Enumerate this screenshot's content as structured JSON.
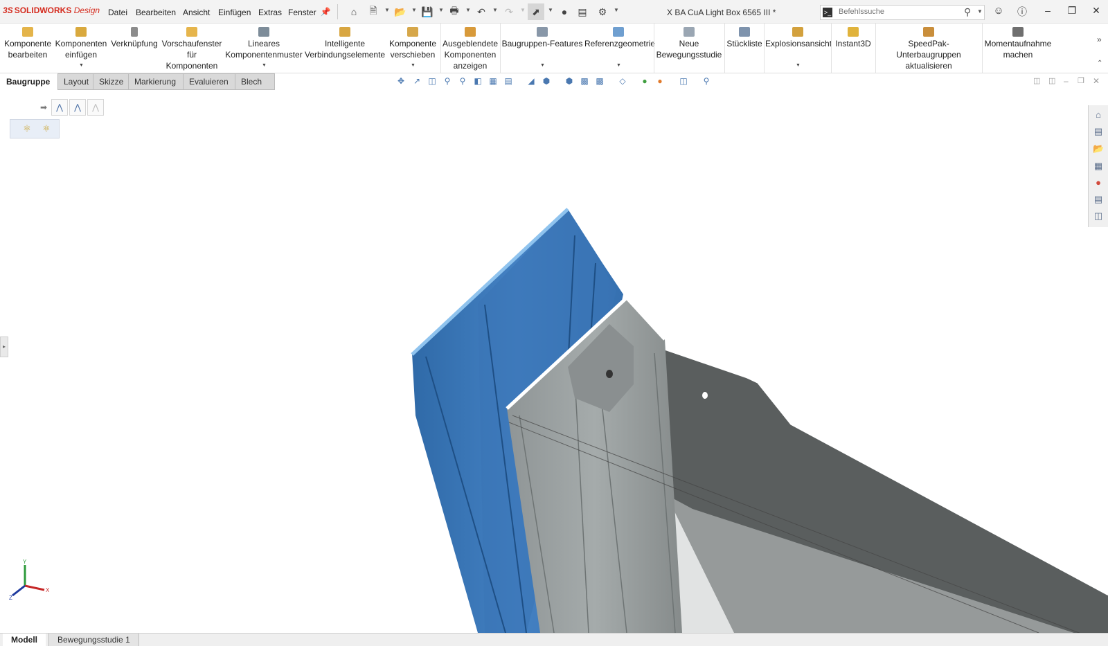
{
  "app": {
    "logo_text": "SOLIDWORKS",
    "logo_suffix": "Design",
    "ds_mark": "3S"
  },
  "menus": [
    "Datei",
    "Bearbeiten",
    "Ansicht",
    "Einfügen",
    "Extras",
    "Fenster"
  ],
  "document_title": "X BA CuA Light Box 6565 III *",
  "search": {
    "placeholder": "Befehlssuche"
  },
  "commands": [
    {
      "label": "Komponente\nbearbeiten",
      "icon": "edit-component-icon"
    },
    {
      "label": "Komponenten\neinfügen",
      "icon": "insert-components-icon"
    },
    {
      "label": "Verknüpfung",
      "icon": "mate-icon"
    },
    {
      "label": "Vorschaufenster\nfür\nKomponenten",
      "icon": "component-preview-icon"
    },
    {
      "label": "Lineares\nKomponentenmuster",
      "icon": "linear-pattern-icon"
    },
    {
      "label": "Intelligente\nVerbindungselemente",
      "icon": "smart-fasteners-icon"
    },
    {
      "label": "Komponente\nverschieben",
      "icon": "move-component-icon"
    },
    {
      "label": "Ausgeblendete\nKomponenten\nanzeigen",
      "icon": "show-hidden-icon"
    },
    {
      "label": "Baugruppen-Features",
      "icon": "assembly-features-icon"
    },
    {
      "label": "Referenzgeometrie",
      "icon": "reference-geometry-icon"
    },
    {
      "label": "Neue\nBewegungsstudie",
      "icon": "motion-study-icon"
    },
    {
      "label": "Stückliste",
      "icon": "bom-icon"
    },
    {
      "label": "Explosionsansicht",
      "icon": "exploded-view-icon"
    },
    {
      "label": "Instant3D",
      "icon": "instant3d-icon"
    },
    {
      "label": "SpeedPak-Unterbaugruppen\naktualisieren",
      "icon": "speedpak-icon"
    },
    {
      "label": "Momentaufnahme\nmachen",
      "icon": "camera-icon"
    }
  ],
  "tabs": [
    "Baugruppe",
    "Layout",
    "Skizze",
    "Markierung",
    "Evaluieren",
    "Blech"
  ],
  "active_tab": "Baugruppe",
  "bottom_tabs": [
    "Modell",
    "Bewegungsstudie 1"
  ],
  "active_bottom_tab": "Modell",
  "triad": {
    "x": "X",
    "y": "Y",
    "z": "Z"
  },
  "colors": {
    "accent": "#d52b1e",
    "profile_blue": "#3f7cc0",
    "profile_grey": "#9fa5a6",
    "panel_dark": "#5b5f5f"
  }
}
